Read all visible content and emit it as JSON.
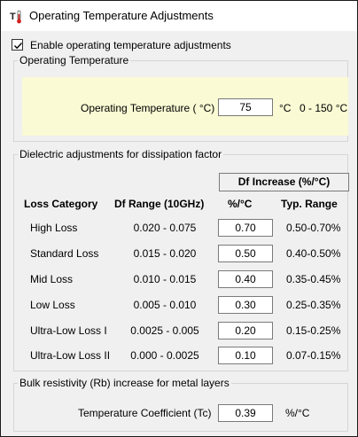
{
  "window": {
    "title": "Operating Temperature Adjustments"
  },
  "enable_checkbox": {
    "label": "Enable operating temperature adjustments",
    "checked": true
  },
  "operating_temperature": {
    "legend": "Operating Temperature",
    "label": "Operating Temperature ( °C)",
    "value": "75",
    "unit": "°C",
    "range": "0 - 150 °C"
  },
  "dielectric": {
    "legend": "Dielectric adjustments for dissipation factor",
    "increase_header": "Df Increase (%/°C)",
    "columns": {
      "category": "Loss Category",
      "range": "Df Range (10GHz)",
      "value": "%/°C",
      "typical": "Typ. Range"
    },
    "rows": [
      {
        "category": "High Loss",
        "range": "0.020 - 0.075",
        "value": "0.70",
        "typical": "0.50-0.70%"
      },
      {
        "category": "Standard Loss",
        "range": "0.015 - 0.020",
        "value": "0.50",
        "typical": "0.40-0.50%"
      },
      {
        "category": "Mid Loss",
        "range": "0.010 - 0.015",
        "value": "0.40",
        "typical": "0.35-0.45%"
      },
      {
        "category": "Low Loss",
        "range": "0.005 - 0.010",
        "value": "0.30",
        "typical": "0.25-0.35%"
      },
      {
        "category": "Ultra-Low Loss I",
        "range": "0.0025 - 0.005",
        "value": "0.20",
        "typical": "0.15-0.25%"
      },
      {
        "category": "Ultra-Low Loss II",
        "range": "0.000 - 0.0025",
        "value": "0.10",
        "typical": "0.07-0.15%"
      }
    ]
  },
  "bulk_resistivity": {
    "legend": "Bulk resistivity (Rb) increase for metal layers",
    "label": "Temperature Coefficient (Tc)",
    "value": "0.39",
    "unit": "%/°C"
  },
  "icons": {
    "app": "thermometer-icon",
    "check": "checkmark-icon"
  },
  "colors": {
    "highlight_panel": "#fafad4",
    "window_background": "#f0f0f0",
    "thermometer_red": "#d42020"
  }
}
